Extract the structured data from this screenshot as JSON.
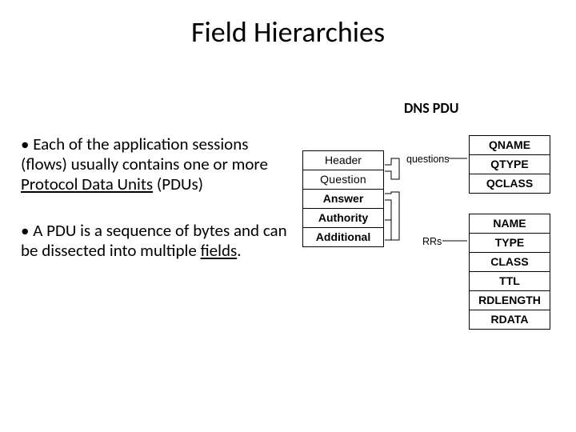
{
  "title": "Field Hierarchies",
  "dns_label": "DNS PDU",
  "paragraphs": {
    "p1_bullet": "• ",
    "p1_a": "Each of the application sessions (flows) usually contains one or more ",
    "p1_u": "Protocol Data Units",
    "p1_b": " (PDUs)",
    "p2_bullet": "• ",
    "p2_a": "A PDU is a sequence of bytes and can be dissected into multiple ",
    "p2_u": "fields",
    "p2_b": "."
  },
  "pdu_sections": {
    "header": "Header",
    "question": "Question",
    "answer": "Answer",
    "authority": "Authority",
    "additional": "Additional"
  },
  "labels": {
    "questions": "questions",
    "rrs": "RRs"
  },
  "question_fields": [
    "QNAME",
    "QTYPE",
    "QCLASS"
  ],
  "rr_fields": [
    "NAME",
    "TYPE",
    "CLASS",
    "TTL",
    "RDLENGTH",
    "RDATA"
  ]
}
